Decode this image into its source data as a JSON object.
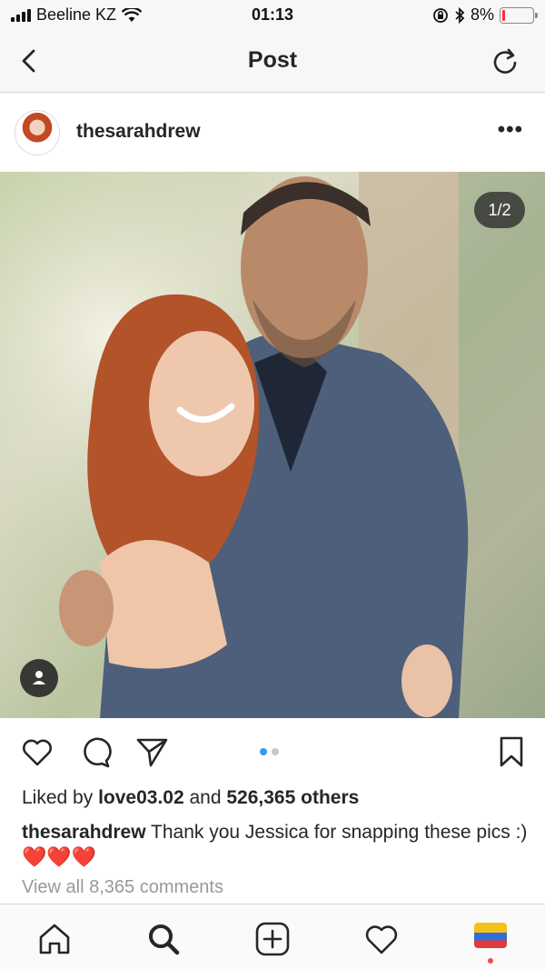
{
  "status_bar": {
    "carrier": "Beeline KZ",
    "time": "01:13",
    "battery_percent": "8%",
    "battery_level": 0.08
  },
  "nav": {
    "title": "Post"
  },
  "post": {
    "username": "thesarahdrew",
    "more_label": "•••",
    "image_counter": "1/2",
    "likes_prefix": "Liked by",
    "liked_by_user": "love03.02",
    "likes_and": "and",
    "likes_others": "526,365 others",
    "caption_user": "thesarahdrew",
    "caption_text": "Thank you Jessica for snapping these pics :)",
    "caption_emoji": "❤️❤️❤️",
    "view_comments": "View all 8,365 comments"
  },
  "carousel": {
    "count": 2,
    "active": 1
  },
  "colors": {
    "accent": "#3897f0",
    "notification": "#ed4956"
  },
  "icons": {
    "nav": [
      "chevron-left-icon",
      "refresh-icon"
    ],
    "actions": [
      "heart-icon",
      "comment-icon",
      "share-icon",
      "bookmark-icon"
    ],
    "tabs": [
      "home-icon",
      "search-icon",
      "add-icon",
      "activity-icon",
      "profile-avatar"
    ]
  }
}
